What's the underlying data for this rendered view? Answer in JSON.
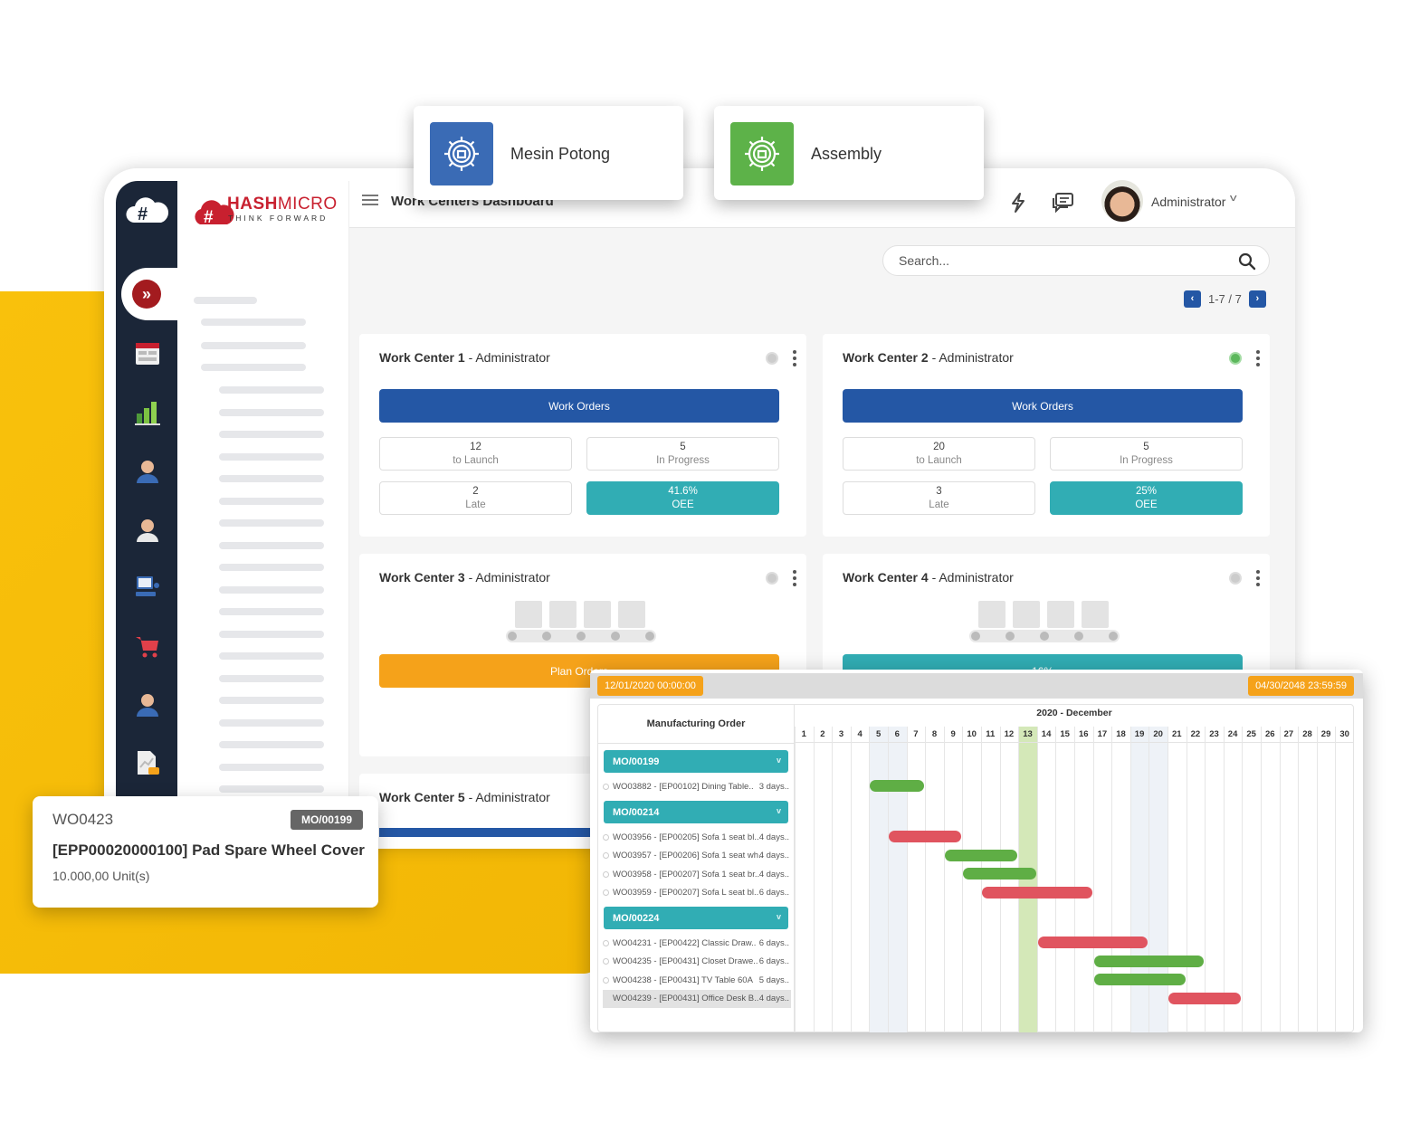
{
  "brand": {
    "name_bold": "HASH",
    "name_light": "MICRO",
    "tagline": "THINK FORWARD"
  },
  "header": {
    "page_title": "Work Centers Dashboard",
    "user_name": "Administrator"
  },
  "floating_chips": [
    {
      "label": "Mesin Potong",
      "color": "#3a6bb5"
    },
    {
      "label": "Assembly",
      "color": "#5db249"
    }
  ],
  "search": {
    "placeholder": "Search..."
  },
  "pager": {
    "range": "1-7 / 7"
  },
  "sidebar_icons": [
    "calendar-icon",
    "bar-chart-icon",
    "employee-list-icon",
    "mail-icon",
    "computer-icon",
    "cart-icon",
    "support-agent-icon",
    "report-icon"
  ],
  "work_centers": [
    {
      "name": "Work Center 1",
      "owner": "- Administrator",
      "active": false,
      "button": "Work Orders",
      "stats": [
        {
          "value": "12",
          "label": "to Launch"
        },
        {
          "value": "5",
          "label": "In Progress"
        },
        {
          "value": "2",
          "label": "Late"
        },
        {
          "value": "41.6%",
          "label": "OEE"
        }
      ]
    },
    {
      "name": "Work Center 2",
      "owner": "- Administrator",
      "active": true,
      "button": "Work Orders",
      "stats": [
        {
          "value": "20",
          "label": "to Launch"
        },
        {
          "value": "5",
          "label": "In Progress"
        },
        {
          "value": "3",
          "label": "Late"
        },
        {
          "value": "25%",
          "label": "OEE"
        }
      ]
    },
    {
      "name": "Work Center 3",
      "owner": "- Administrator",
      "active": false,
      "button": "Plan Orders"
    },
    {
      "name": "Work Center 4",
      "owner": "- Administrator",
      "active": false,
      "button": "16%"
    },
    {
      "name": "Work Center 5",
      "owner": "- Administrator"
    }
  ],
  "work_order_card": {
    "code": "WO0423",
    "mo_badge": "MO/00199",
    "product": "[EPP00020000100] Pad Spare Wheel Cover",
    "quantity": "10.000,00 Unit(s)"
  },
  "gantt": {
    "start_date": "12/01/2020 00:00:00",
    "end_date": "04/30/2048 23:59:59",
    "column_header": "Manufacturing Order",
    "month_label": "2020 - December",
    "days": [
      1,
      2,
      3,
      4,
      5,
      6,
      7,
      8,
      9,
      10,
      11,
      12,
      13,
      14,
      15,
      16,
      17,
      18,
      19,
      20,
      21,
      22,
      23,
      24,
      25,
      26,
      27,
      28,
      29,
      30
    ],
    "today": 13,
    "weekend_days": [
      5,
      6,
      19,
      20
    ],
    "groups": [
      {
        "mo": "MO/00199",
        "rows": [
          {
            "label": "WO03882 - [EP00102] Dining Table..",
            "duration": "3 days..",
            "start": 5,
            "end": 7,
            "status": "on-track"
          }
        ]
      },
      {
        "mo": "MO/00214",
        "rows": [
          {
            "label": "WO03956 - [EP00205] Sofa 1 seat bl..",
            "duration": "4 days..",
            "start": 6,
            "end": 9,
            "status": "late"
          },
          {
            "label": "WO03957 - [EP00206] Sofa 1 seat wh..",
            "duration": "4 days..",
            "start": 9,
            "end": 12,
            "status": "on-track"
          },
          {
            "label": "WO03958 - [EP00207] Sofa 1 seat br..",
            "duration": "4 days..",
            "start": 10,
            "end": 13,
            "status": "on-track"
          },
          {
            "label": "WO03959 - [EP00207] Sofa L seat bl..",
            "duration": "6 days..",
            "start": 11,
            "end": 16,
            "status": "late"
          }
        ]
      },
      {
        "mo": "MO/00224",
        "rows": [
          {
            "label": "WO04231 - [EP00422] Classic Draw..",
            "duration": "6 days..",
            "start": 14,
            "end": 19,
            "status": "late"
          },
          {
            "label": "WO04235 - [EP00431] Closet Drawe..",
            "duration": "6 days..",
            "start": 17,
            "end": 22,
            "status": "on-track"
          },
          {
            "label": "WO04238 - [EP00431] TV Table 60A",
            "duration": "5 days..",
            "start": 17,
            "end": 21,
            "status": "on-track"
          },
          {
            "label": "WO04239 - [EP00431] Office Desk B..",
            "duration": "4 days..",
            "start": 21,
            "end": 24,
            "status": "late",
            "selected": true
          }
        ]
      }
    ],
    "colors": {
      "on-track": "#5fae45",
      "late": "#e0545f",
      "today": "#d4e8b8",
      "weekend": "#eef2f7"
    }
  }
}
